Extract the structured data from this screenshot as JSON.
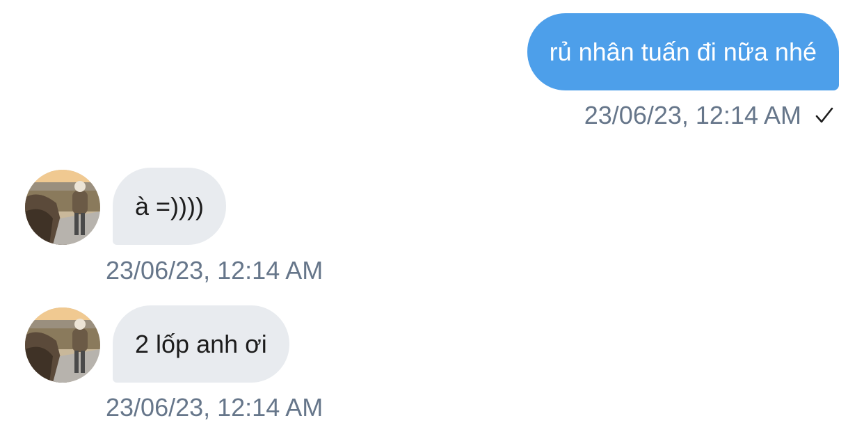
{
  "messages": [
    {
      "direction": "outgoing",
      "text": "rủ nhân tuấn đi nữa nhé",
      "timestamp": "23/06/23, 12:14 AM",
      "status_icon": "check-icon"
    },
    {
      "direction": "incoming",
      "text": "à =))))",
      "timestamp": "23/06/23, 12:14 AM",
      "avatar_icon": "avatar"
    },
    {
      "direction": "incoming",
      "text": "2 lốp anh ơi",
      "timestamp": "23/06/23, 12:14 AM",
      "avatar_icon": "avatar"
    }
  ],
  "colors": {
    "outgoing_bubble": "#4d9fea",
    "incoming_bubble": "#e8ebef",
    "timestamp": "#66768a"
  }
}
